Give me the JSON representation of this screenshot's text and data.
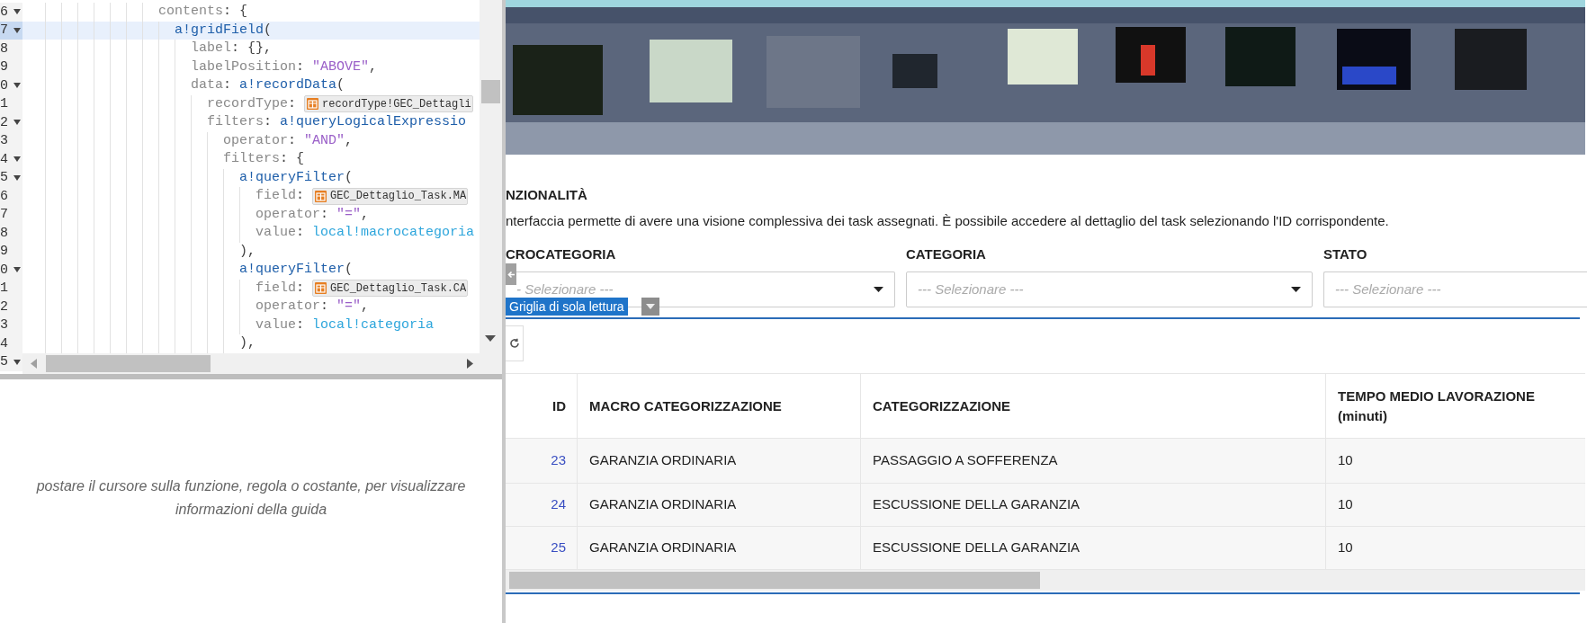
{
  "code_editor": {
    "lines": [
      {
        "number": "6",
        "foldable": true,
        "highlighted": false,
        "tokens": [
          {
            "kind": "key",
            "text": "                contents"
          },
          {
            "kind": "punct",
            "text": ": {"
          }
        ]
      },
      {
        "number": "7",
        "foldable": true,
        "highlighted": true,
        "tokens": [
          {
            "kind": "fn",
            "text": "                  a!gridField"
          },
          {
            "kind": "punct",
            "text": "("
          }
        ]
      },
      {
        "number": "8",
        "foldable": false,
        "highlighted": false,
        "tokens": [
          {
            "kind": "key",
            "text": "                    label"
          },
          {
            "kind": "punct",
            "text": ": {},"
          }
        ]
      },
      {
        "number": "9",
        "foldable": false,
        "highlighted": false,
        "tokens": [
          {
            "kind": "key",
            "text": "                    labelPosition"
          },
          {
            "kind": "punct",
            "text": ": "
          },
          {
            "kind": "str",
            "text": "\"ABOVE\""
          },
          {
            "kind": "punct",
            "text": ","
          }
        ]
      },
      {
        "number": "0",
        "foldable": true,
        "highlighted": false,
        "tokens": [
          {
            "kind": "key",
            "text": "                    data"
          },
          {
            "kind": "punct",
            "text": ": "
          },
          {
            "kind": "fn",
            "text": "a!recordData"
          },
          {
            "kind": "punct",
            "text": "("
          }
        ]
      },
      {
        "number": "1",
        "foldable": false,
        "highlighted": false,
        "tokens": [
          {
            "kind": "key",
            "text": "                      recordType"
          },
          {
            "kind": "punct",
            "text": ": "
          },
          {
            "kind": "chip",
            "text": "recordType!GEC_Dettagli"
          }
        ]
      },
      {
        "number": "2",
        "foldable": true,
        "highlighted": false,
        "tokens": [
          {
            "kind": "key",
            "text": "                      filters"
          },
          {
            "kind": "punct",
            "text": ": "
          },
          {
            "kind": "fn",
            "text": "a!queryLogicalExpressio"
          }
        ]
      },
      {
        "number": "3",
        "foldable": false,
        "highlighted": false,
        "tokens": [
          {
            "kind": "key",
            "text": "                        operator"
          },
          {
            "kind": "punct",
            "text": ": "
          },
          {
            "kind": "str",
            "text": "\"AND\""
          },
          {
            "kind": "punct",
            "text": ","
          }
        ]
      },
      {
        "number": "4",
        "foldable": true,
        "highlighted": false,
        "tokens": [
          {
            "kind": "key",
            "text": "                        filters"
          },
          {
            "kind": "punct",
            "text": ": {"
          }
        ]
      },
      {
        "number": "5",
        "foldable": true,
        "highlighted": false,
        "tokens": [
          {
            "kind": "fn",
            "text": "                          a!queryFilter"
          },
          {
            "kind": "punct",
            "text": "("
          }
        ]
      },
      {
        "number": "6",
        "foldable": false,
        "highlighted": false,
        "tokens": [
          {
            "kind": "key",
            "text": "                            field"
          },
          {
            "kind": "punct",
            "text": ": "
          },
          {
            "kind": "chip",
            "text": "GEC_Dettaglio_Task.MA"
          }
        ]
      },
      {
        "number": "7",
        "foldable": false,
        "highlighted": false,
        "tokens": [
          {
            "kind": "key",
            "text": "                            operator"
          },
          {
            "kind": "punct",
            "text": ": "
          },
          {
            "kind": "str",
            "text": "\"=\""
          },
          {
            "kind": "punct",
            "text": ","
          }
        ]
      },
      {
        "number": "8",
        "foldable": false,
        "highlighted": false,
        "tokens": [
          {
            "kind": "key",
            "text": "                            value"
          },
          {
            "kind": "punct",
            "text": ": "
          },
          {
            "kind": "var",
            "text": "local!macrocategoria"
          }
        ]
      },
      {
        "number": "9",
        "foldable": false,
        "highlighted": false,
        "tokens": [
          {
            "kind": "punct",
            "text": "                          ),"
          }
        ]
      },
      {
        "number": "0",
        "foldable": true,
        "highlighted": false,
        "tokens": [
          {
            "kind": "fn",
            "text": "                          a!queryFilter"
          },
          {
            "kind": "punct",
            "text": "("
          }
        ]
      },
      {
        "number": "1",
        "foldable": false,
        "highlighted": false,
        "tokens": [
          {
            "kind": "key",
            "text": "                            field"
          },
          {
            "kind": "punct",
            "text": ": "
          },
          {
            "kind": "chip",
            "text": "GEC_Dettaglio_Task.CA"
          }
        ]
      },
      {
        "number": "2",
        "foldable": false,
        "highlighted": false,
        "tokens": [
          {
            "kind": "key",
            "text": "                            operator"
          },
          {
            "kind": "punct",
            "text": ": "
          },
          {
            "kind": "str",
            "text": "\"=\""
          },
          {
            "kind": "punct",
            "text": ","
          }
        ]
      },
      {
        "number": "3",
        "foldable": false,
        "highlighted": false,
        "tokens": [
          {
            "kind": "key",
            "text": "                            value"
          },
          {
            "kind": "punct",
            "text": ": "
          },
          {
            "kind": "var",
            "text": "local!categoria"
          }
        ]
      },
      {
        "number": "4",
        "foldable": false,
        "highlighted": false,
        "tokens": [
          {
            "kind": "punct",
            "text": "                          ),"
          }
        ]
      },
      {
        "number": "5",
        "foldable": true,
        "highlighted": false
      }
    ]
  },
  "help_text": "postare il cursore sulla funzione, regola o costante, per visualizzare informazioni della guida",
  "page": {
    "heading": "NZIONALITÀ",
    "description": "nterfaccia permette di avere una visione complessiva dei task assegnati. È possibile accedere al dettaglio del task selezionando l'ID corrispondente.",
    "filters": [
      {
        "label": "CROCATEGORIA",
        "placeholder": "- Selezionare ---",
        "caret": true
      },
      {
        "label": "CATEGORIA",
        "placeholder": "--- Selezionare ---",
        "caret": true
      },
      {
        "label": "STATO",
        "placeholder": "--- Selezionare ---",
        "caret": false
      }
    ],
    "grid_tag": "Griglia di sola lettura",
    "table": {
      "columns": [
        "ID",
        "MACRO CATEGORIZZAZIONE",
        "CATEGORIZZAZIONE",
        "TEMPO MEDIO LAVORAZIONE (minuti)"
      ],
      "rows": [
        [
          "23",
          "GARANZIA ORDINARIA",
          "PASSAGGIO A SOFFERENZA",
          "10"
        ],
        [
          "24",
          "GARANZIA ORDINARIA",
          "ESCUSSIONE DELLA GARANZIA",
          "10"
        ],
        [
          "25",
          "GARANZIA ORDINARIA",
          "ESCUSSIONE DELLA GARANZIA",
          "10"
        ]
      ]
    }
  }
}
